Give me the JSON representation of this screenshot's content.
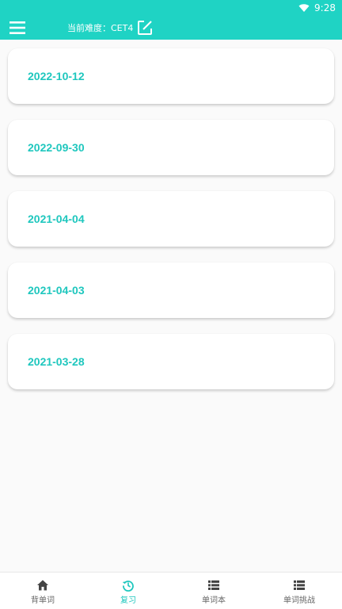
{
  "status_bar": {
    "time": "9:28",
    "icons": [
      "wifi-icon"
    ]
  },
  "app_bar": {
    "difficulty_label": "当前难度：CET4",
    "icons": [
      "menu-icon",
      "edit-icon"
    ]
  },
  "review_dates": [
    "2022-10-12",
    "2022-09-30",
    "2021-04-04",
    "2021-04-03",
    "2021-03-28"
  ],
  "bottom_nav": {
    "items": [
      {
        "label": "背单词",
        "icon": "home-icon",
        "active": false
      },
      {
        "label": "复习",
        "icon": "history-icon",
        "active": true
      },
      {
        "label": "单词本",
        "icon": "list-icon",
        "active": false
      },
      {
        "label": "单词挑战",
        "icon": "list-icon",
        "active": false
      }
    ]
  },
  "colors": {
    "accent": "#1fd3c4",
    "date_text": "#1fc7be",
    "background": "#fafafa",
    "nav_inactive": "#666666"
  }
}
